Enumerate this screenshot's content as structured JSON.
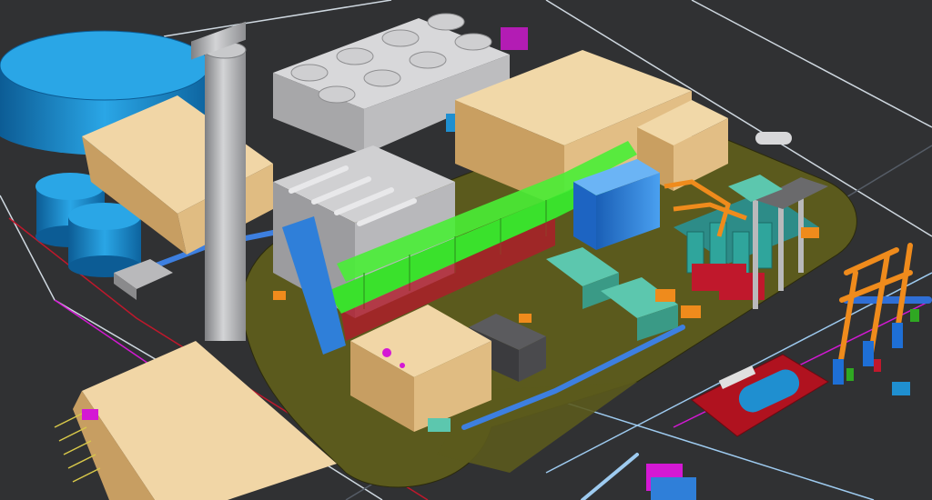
{
  "scene": {
    "background": "#303133",
    "colors": {
      "pad": "#5b5a1d",
      "tan_building": "#efcf98",
      "tank_blue": "#1f8fd0",
      "stack_gray": "#a9aaad",
      "cooling_gray": "#c9c9cb",
      "pipe_green": "#38e22a",
      "hrsg_blue": "#2f7fd9",
      "orange": "#ef8b1c",
      "teal": "#53c0a8",
      "red": "#c0182c",
      "magenta": "#d418d4",
      "cyan_line": "#9ecbf0",
      "yellow_stripe": "#d8c84a"
    },
    "components": [
      {
        "id": "storage-tank-large",
        "label": ""
      },
      {
        "id": "storage-tank-small-1",
        "label": ""
      },
      {
        "id": "storage-tank-small-2",
        "label": ""
      },
      {
        "id": "exhaust-stack",
        "label": ""
      },
      {
        "id": "cooling-tower",
        "label": ""
      },
      {
        "id": "turbine-building",
        "label": ""
      },
      {
        "id": "hrsg-unit",
        "label": ""
      },
      {
        "id": "pipe-rack",
        "label": ""
      },
      {
        "id": "transformer-yard",
        "label": ""
      },
      {
        "id": "transmission-towers",
        "label": ""
      },
      {
        "id": "fuel-skid",
        "label": ""
      },
      {
        "id": "parking-building",
        "label": ""
      }
    ]
  }
}
